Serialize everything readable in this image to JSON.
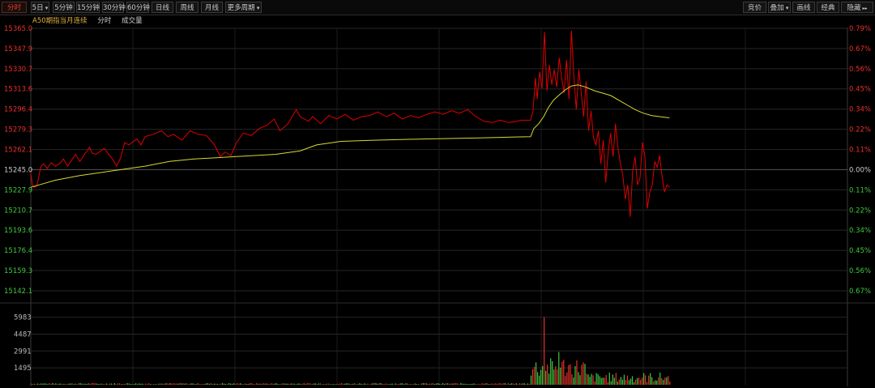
{
  "toolbar": {
    "left_buttons": [
      {
        "label": "分时",
        "active": true,
        "caret": false
      },
      {
        "label": "5日",
        "active": false,
        "caret": true
      },
      {
        "label": "5分钟",
        "active": false,
        "caret": false
      },
      {
        "label": "15分钟",
        "active": false,
        "caret": false
      },
      {
        "label": "30分钟",
        "active": false,
        "caret": false
      },
      {
        "label": "60分钟",
        "active": false,
        "caret": false
      },
      {
        "label": "日线",
        "active": false,
        "caret": false
      },
      {
        "label": "周线",
        "active": false,
        "caret": false
      },
      {
        "label": "月线",
        "active": false,
        "caret": false
      },
      {
        "label": "更多周期",
        "active": false,
        "caret": true
      }
    ],
    "right_buttons": [
      {
        "label": "竞价",
        "caret": false,
        "dbl": false
      },
      {
        "label": "叠加",
        "caret": true,
        "dbl": false
      },
      {
        "label": "画线",
        "caret": false,
        "dbl": false
      },
      {
        "label": "经典",
        "caret": false,
        "dbl": false
      },
      {
        "label": "隐藏",
        "caret": false,
        "dbl": true
      }
    ]
  },
  "subtitle": {
    "instrument": "A50期指当月连续",
    "mode": "分时",
    "volume": "成交量"
  },
  "colors": {
    "up": "#e8302a",
    "down": "#3ec83e",
    "price_line": "#e00000",
    "avg_line": "#d8d830",
    "grid": "#262626",
    "grid_base": "#555555"
  },
  "chart_data": {
    "type": "line",
    "price_axis": {
      "ylim": [
        15142.1,
        15365.0
      ],
      "base": 15245.0,
      "ticks": [
        "15365.0",
        "15347.9",
        "15330.7",
        "15313.6",
        "15296.4",
        "15279.3",
        "15262.1",
        "15245.0",
        "15227.9",
        "15210.7",
        "15193.6",
        "15176.4",
        "15159.3",
        "15142.1"
      ],
      "pct_ticks": [
        "0.79%",
        "0.67%",
        "0.56%",
        "0.45%",
        "0.34%",
        "0.22%",
        "0.11%",
        "0.00%",
        "0.11%",
        "0.22%",
        "0.34%",
        "0.45%",
        "0.56%",
        "0.67%"
      ]
    },
    "x_range": [
      0,
      1000
    ],
    "series": [
      {
        "kind": "price",
        "points": [
          [
            0,
            15242
          ],
          [
            2,
            15232
          ],
          [
            4,
            15230
          ],
          [
            7,
            15231
          ],
          [
            9,
            15236
          ],
          [
            12,
            15247
          ],
          [
            16,
            15250
          ],
          [
            20,
            15246
          ],
          [
            25,
            15251
          ],
          [
            30,
            15248
          ],
          [
            35,
            15250
          ],
          [
            40,
            15254
          ],
          [
            45,
            15248
          ],
          [
            50,
            15253
          ],
          [
            55,
            15258
          ],
          [
            60,
            15252
          ],
          [
            65,
            15257
          ],
          [
            72,
            15264
          ],
          [
            75,
            15259
          ],
          [
            80,
            15258
          ],
          [
            90,
            15263
          ],
          [
            100,
            15254
          ],
          [
            105,
            15248
          ],
          [
            110,
            15255
          ],
          [
            115,
            15268
          ],
          [
            120,
            15266
          ],
          [
            130,
            15271
          ],
          [
            135,
            15266
          ],
          [
            140,
            15273
          ],
          [
            150,
            15275
          ],
          [
            160,
            15278
          ],
          [
            168,
            15273
          ],
          [
            175,
            15275
          ],
          [
            185,
            15270
          ],
          [
            195,
            15278
          ],
          [
            205,
            15275
          ],
          [
            215,
            15274
          ],
          [
            225,
            15266
          ],
          [
            232,
            15256
          ],
          [
            238,
            15260
          ],
          [
            245,
            15257
          ],
          [
            252,
            15268
          ],
          [
            260,
            15276
          ],
          [
            270,
            15274
          ],
          [
            280,
            15280
          ],
          [
            290,
            15283
          ],
          [
            298,
            15288
          ],
          [
            305,
            15278
          ],
          [
            315,
            15284
          ],
          [
            325,
            15296
          ],
          [
            330,
            15290
          ],
          [
            340,
            15286
          ],
          [
            345,
            15290
          ],
          [
            355,
            15284
          ],
          [
            365,
            15291
          ],
          [
            375,
            15288
          ],
          [
            385,
            15292
          ],
          [
            395,
            15287
          ],
          [
            405,
            15290
          ],
          [
            415,
            15291
          ],
          [
            425,
            15294
          ],
          [
            435,
            15290
          ],
          [
            445,
            15293
          ],
          [
            455,
            15288
          ],
          [
            465,
            15291
          ],
          [
            475,
            15289
          ],
          [
            485,
            15292
          ],
          [
            495,
            15294
          ],
          [
            505,
            15292
          ],
          [
            515,
            15295
          ],
          [
            525,
            15293
          ],
          [
            535,
            15296
          ],
          [
            545,
            15290
          ],
          [
            555,
            15286
          ],
          [
            565,
            15285
          ],
          [
            575,
            15287
          ],
          [
            585,
            15285
          ],
          [
            595,
            15286
          ],
          [
            600,
            15287
          ],
          [
            612,
            15287
          ],
          [
            615,
            15295
          ],
          [
            618,
            15323
          ],
          [
            620,
            15305
          ],
          [
            623,
            15328
          ],
          [
            626,
            15314
          ],
          [
            629,
            15362
          ],
          [
            632,
            15312
          ],
          [
            635,
            15334
          ],
          [
            638,
            15317
          ],
          [
            641,
            15330
          ],
          [
            644,
            15315
          ],
          [
            647,
            15340
          ],
          [
            650,
            15323
          ],
          [
            653,
            15310
          ],
          [
            656,
            15338
          ],
          [
            659,
            15305
          ],
          [
            662,
            15363
          ],
          [
            665,
            15325
          ],
          [
            668,
            15296
          ],
          [
            671,
            15330
          ],
          [
            674,
            15310
          ],
          [
            677,
            15290
          ],
          [
            680,
            15320
          ],
          [
            683,
            15278
          ],
          [
            686,
            15295
          ],
          [
            689,
            15272
          ],
          [
            692,
            15266
          ],
          [
            695,
            15278
          ],
          [
            698,
            15250
          ],
          [
            701,
            15270
          ],
          [
            704,
            15234
          ],
          [
            707,
            15260
          ],
          [
            710,
            15276
          ],
          [
            713,
            15256
          ],
          [
            716,
            15284
          ],
          [
            719,
            15263
          ],
          [
            722,
            15250
          ],
          [
            725,
            15240
          ],
          [
            728,
            15220
          ],
          [
            731,
            15232
          ],
          [
            734,
            15205
          ],
          [
            737,
            15244
          ],
          [
            740,
            15256
          ],
          [
            743,
            15232
          ],
          [
            746,
            15238
          ],
          [
            749,
            15268
          ],
          [
            752,
            15256
          ],
          [
            755,
            15212
          ],
          [
            758,
            15226
          ],
          [
            761,
            15232
          ],
          [
            764,
            15252
          ],
          [
            767,
            15247
          ],
          [
            770,
            15257
          ],
          [
            773,
            15239
          ],
          [
            776,
            15226
          ],
          [
            779,
            15232
          ],
          [
            782,
            15230
          ]
        ]
      },
      {
        "kind": "average",
        "points": [
          [
            0,
            15230
          ],
          [
            10,
            15232
          ],
          [
            30,
            15236
          ],
          [
            60,
            15240
          ],
          [
            100,
            15244
          ],
          [
            140,
            15248
          ],
          [
            170,
            15252
          ],
          [
            200,
            15254
          ],
          [
            250,
            15256
          ],
          [
            300,
            15258
          ],
          [
            330,
            15261
          ],
          [
            350,
            15266
          ],
          [
            380,
            15269
          ],
          [
            420,
            15270
          ],
          [
            480,
            15271
          ],
          [
            550,
            15272
          ],
          [
            612,
            15273
          ],
          [
            616,
            15280
          ],
          [
            622,
            15284
          ],
          [
            628,
            15290
          ],
          [
            634,
            15298
          ],
          [
            640,
            15304
          ],
          [
            648,
            15309
          ],
          [
            655,
            15313
          ],
          [
            662,
            15316
          ],
          [
            670,
            15317
          ],
          [
            680,
            15315
          ],
          [
            690,
            15312
          ],
          [
            700,
            15310
          ],
          [
            710,
            15308
          ],
          [
            720,
            15304
          ],
          [
            730,
            15300
          ],
          [
            740,
            15296
          ],
          [
            750,
            15293
          ],
          [
            760,
            15291
          ],
          [
            770,
            15290
          ],
          [
            782,
            15289
          ]
        ]
      }
    ],
    "volume_axis": {
      "ylim": [
        0,
        6600
      ],
      "ticks": [
        "5983",
        "4487",
        "2991",
        "1495"
      ]
    },
    "volume": {
      "seed": 7
    }
  }
}
